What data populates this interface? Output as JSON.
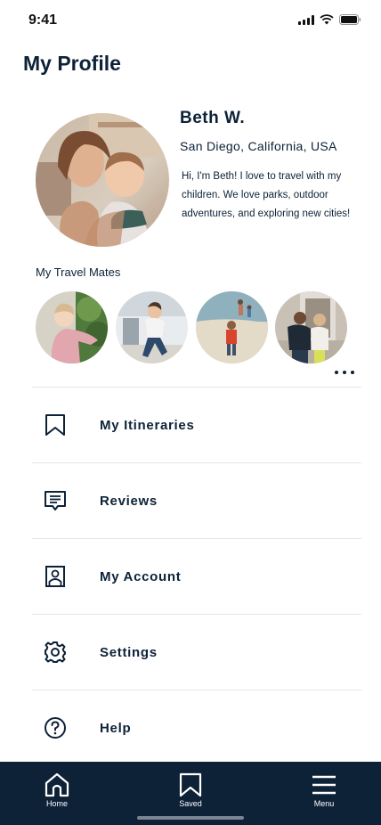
{
  "status_bar": {
    "time": "9:41"
  },
  "page": {
    "title": "My Profile"
  },
  "profile": {
    "name": "Beth W.",
    "location": "San Diego, California, USA",
    "bio": "Hi, I'm Beth! I love to travel with my children. We love parks, outdoor adventures, and exploring new cities!"
  },
  "travel_mates": {
    "title": "My Travel Mates",
    "count": 4
  },
  "menu": {
    "items": [
      {
        "label": "My Itineraries",
        "icon": "bookmark-icon"
      },
      {
        "label": "Reviews",
        "icon": "review-icon"
      },
      {
        "label": "My Account",
        "icon": "account-icon"
      },
      {
        "label": "Settings",
        "icon": "gear-icon"
      },
      {
        "label": "Help",
        "icon": "help-icon"
      }
    ]
  },
  "tab_bar": {
    "tabs": [
      {
        "label": "Home",
        "icon": "home-icon"
      },
      {
        "label": "Saved",
        "icon": "bookmark-icon"
      },
      {
        "label": "Menu",
        "icon": "menu-icon"
      }
    ]
  },
  "colors": {
    "primary": "#0d2137",
    "divider": "#e3e5e8",
    "background": "#ffffff"
  }
}
